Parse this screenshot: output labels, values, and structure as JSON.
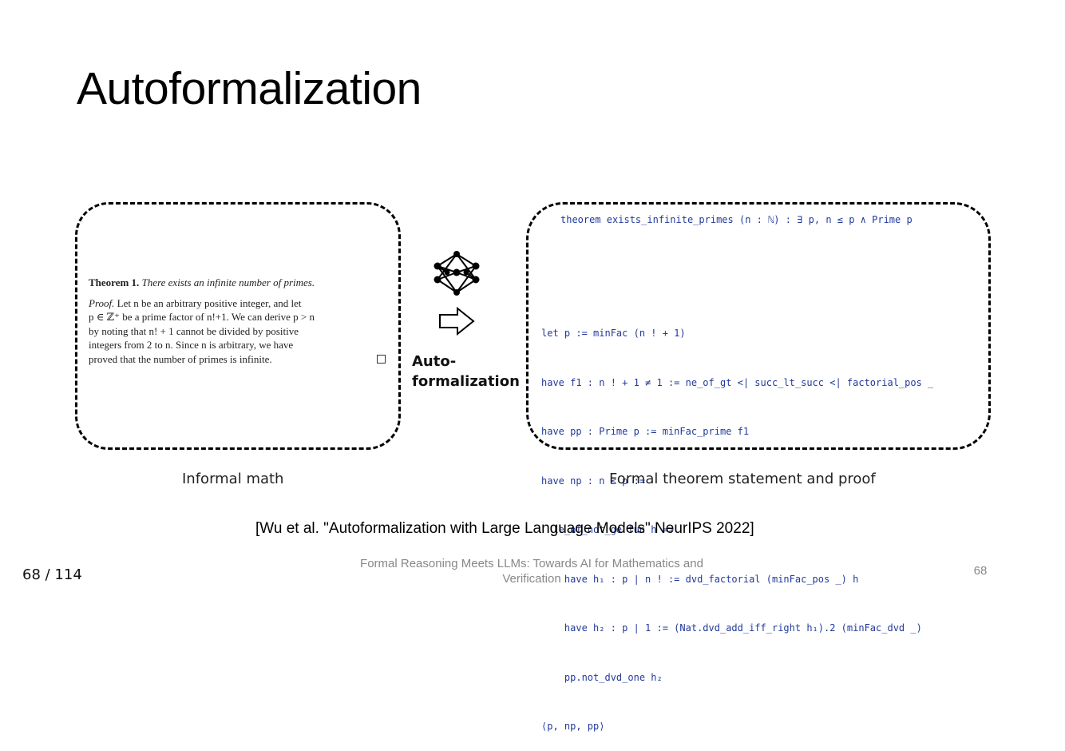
{
  "slide": {
    "title": "Autoformalization"
  },
  "informal": {
    "theorem_label": "Theorem 1.",
    "theorem_statement": "There exists an infinite number of primes.",
    "proof_label": "Proof.",
    "proof_lines": [
      " Let n be an arbitrary positive integer, and let",
      "p ∈ ℤ⁺ be a prime factor of n!+1. We can derive p > n",
      "by noting that n! + 1 cannot be divided by positive",
      "integers from 2 to n. Since n is arbitrary, we have",
      "proved that the number of primes is infinite."
    ],
    "caption": "Informal math"
  },
  "middle": {
    "label_line1": "Auto-",
    "label_line2": "formalization"
  },
  "formal": {
    "statement": "theorem exists_infinite_primes (n : ℕ) : ∃ p, n ≤ p ∧ Prime p",
    "proof_lines": [
      "let p := minFac (n ! + 1)",
      "have f1 : n ! + 1 ≠ 1 := ne_of_gt <| succ_lt_succ <| factorial_pos _",
      "have pp : Prime p := minFac_prime f1",
      "have np : n ≤ p :=",
      "  le_of_not_ge fun h =>",
      "    have h₁ : p ∣ n ! := dvd_factorial (minFac_pos _) h",
      "    have h₂ : p ∣ 1 := (Nat.dvd_add_iff_right h₁).2 (minFac_dvd _)",
      "    pp.not_dvd_one h₂",
      "⟨p, np, pp⟩"
    ],
    "caption": "Formal theorem statement and proof"
  },
  "citation": "[Wu et al. \"Autoformalization with Large Language Models\" NeurIPS 2022]",
  "footer": {
    "page_counter": "68 / 114",
    "center_line1": "Formal Reasoning Meets LLMs: Towards AI for Mathematics and",
    "center_line2": "Verification",
    "page_number": "68"
  },
  "icons": {
    "network": "neural-network-icon",
    "arrow": "right-arrow-icon"
  }
}
